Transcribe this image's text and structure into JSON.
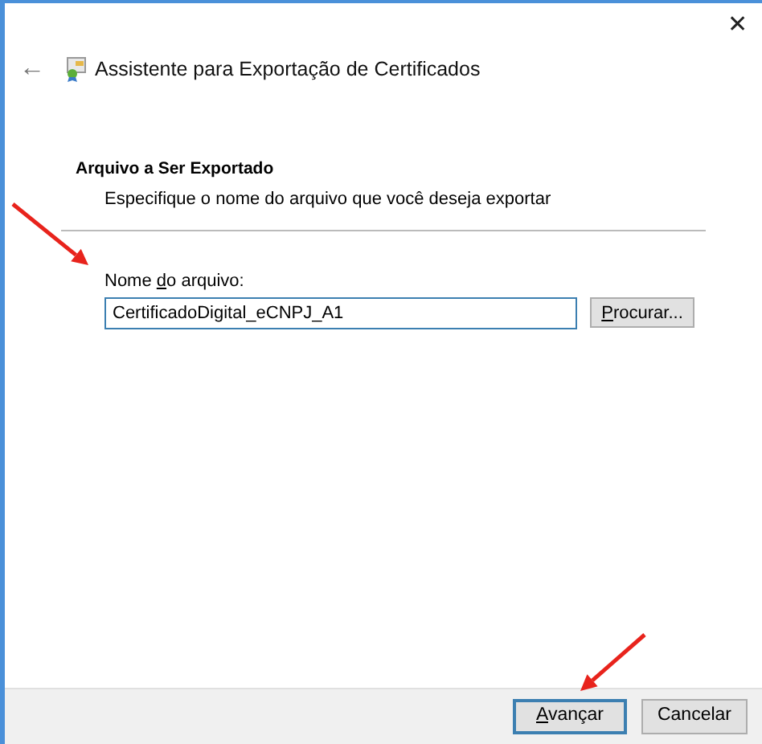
{
  "window": {
    "close": "✕"
  },
  "wizard": {
    "back": "←",
    "title": "Assistente para Exportação de Certificados"
  },
  "section": {
    "heading": "Arquivo a Ser Exportado",
    "description": "Especifique o nome do arquivo que você deseja exportar"
  },
  "file_name": {
    "label": {
      "before": "Nome ",
      "key": "d",
      "after": "o arquivo:"
    },
    "value": "CertificadoDigital_eCNPJ_A1",
    "focused": true
  },
  "browse_button": {
    "key": "P",
    "after": "rocurar..."
  },
  "buttons": [
    {
      "label": {
        "key": "A",
        "after": "vançar"
      },
      "default": true
    },
    {
      "label": {
        "after": "Cancelar"
      },
      "default": false
    }
  ],
  "annotations": [
    {
      "kind": "arrow"
    },
    {
      "kind": "arrow"
    }
  ]
}
